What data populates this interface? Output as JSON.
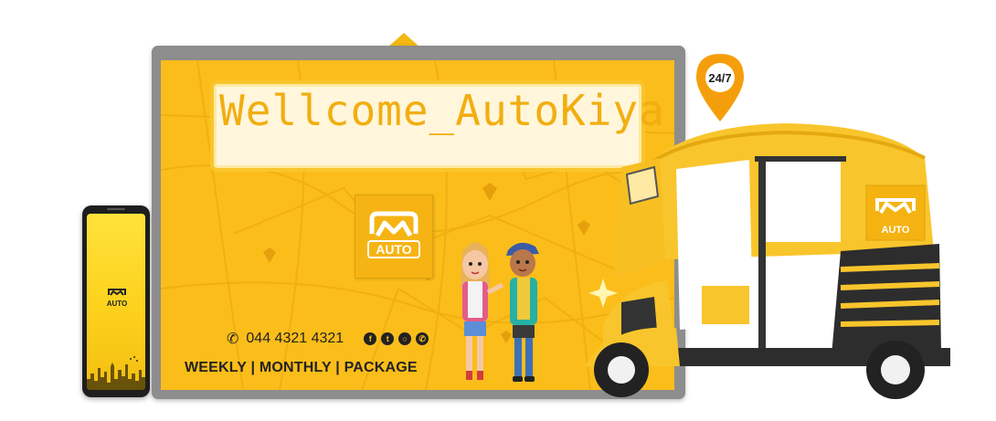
{
  "banner": {
    "welcome_title": "Wellcome_AutoKiya",
    "brand_logo_text": "AUTO",
    "phone_number": "044 4321 4321",
    "plans_text": "WEEKLY | MONTHLY | PACKAGE",
    "availability_badge": "24/7",
    "social_icons": [
      "facebook-icon",
      "twitter-icon",
      "instagram-icon",
      "whatsapp-icon"
    ]
  },
  "phone_app": {
    "logo_text": "AUTO"
  },
  "colors": {
    "brand_yellow": "#fbbd1a",
    "frame_gray": "#8d8d8d",
    "pin_orange": "#f59e0b",
    "dark": "#222222"
  }
}
